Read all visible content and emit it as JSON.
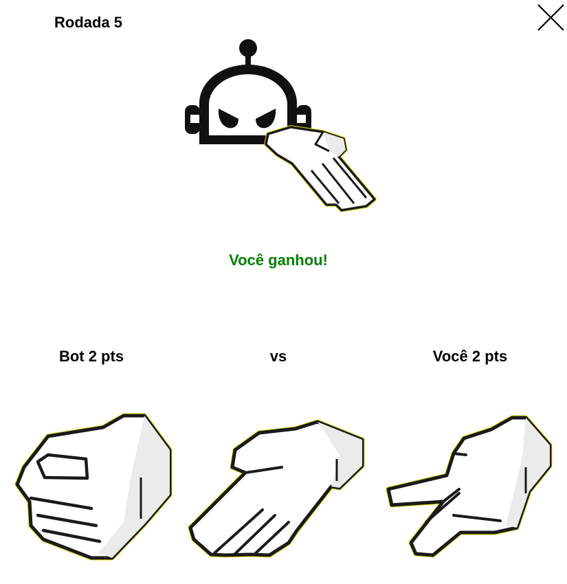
{
  "header": {
    "round_label": "Rodada 5"
  },
  "bot": {
    "avatar_icon": "robot-icon",
    "hand_icon": "paper-hand-icon"
  },
  "result": {
    "text": "Você ganhou!",
    "color": "#008000"
  },
  "scoreboard": {
    "bot_score": "Bot 2 pts",
    "versus": "vs",
    "player_score": "Você 2 pts"
  },
  "choices": [
    {
      "icon": "rock-hand-icon"
    },
    {
      "icon": "paper-hand-icon"
    },
    {
      "icon": "scissors-hand-icon"
    }
  ],
  "colors": {
    "outline": "#1a1a1a",
    "outline_glow": "#e0d800",
    "hand_fill": "#ffffff",
    "hand_shade": "#ebebeb",
    "robot": "#111111"
  }
}
